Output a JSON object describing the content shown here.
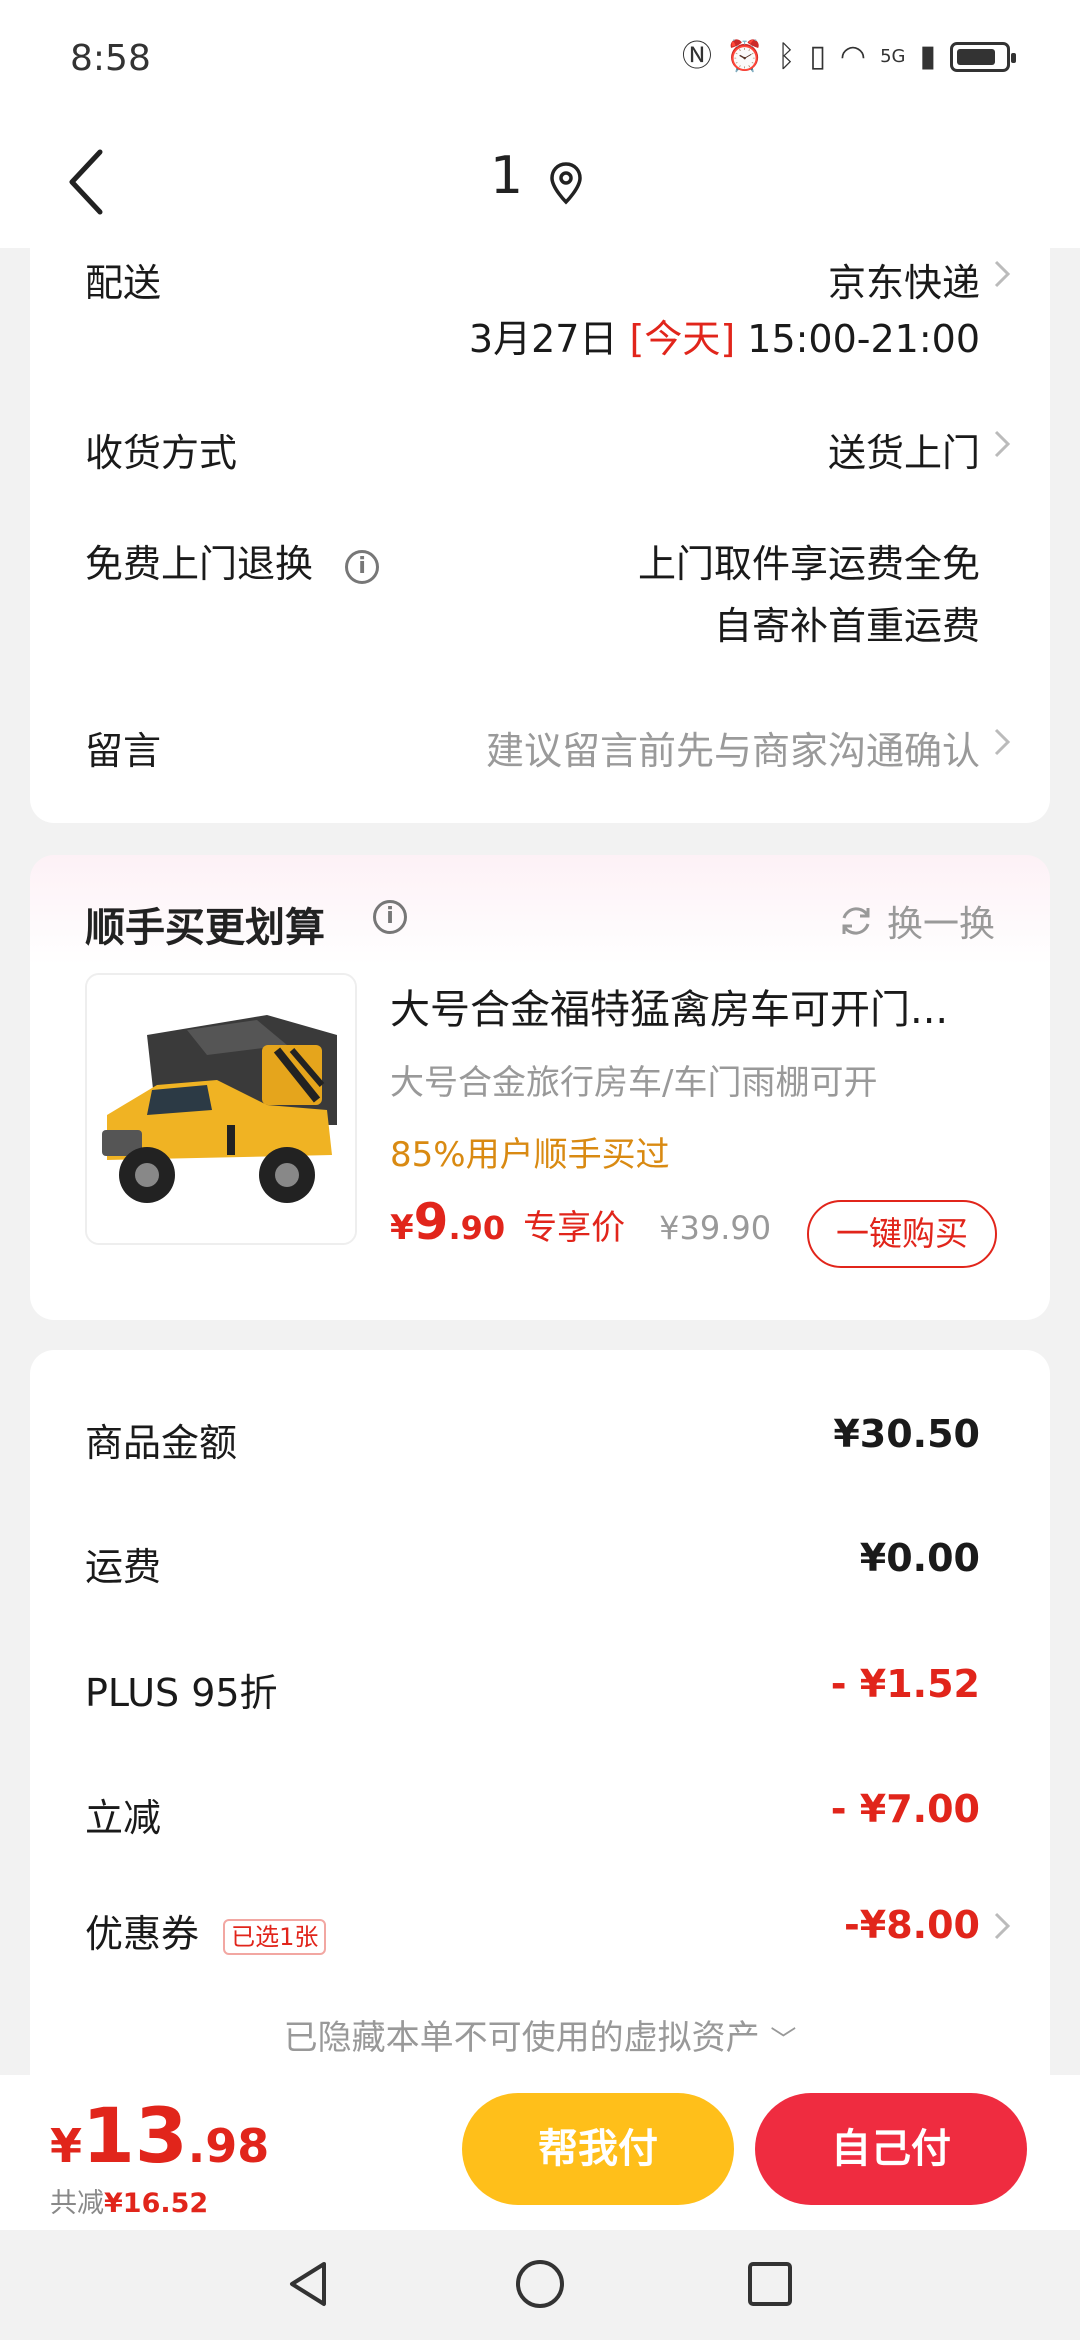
{
  "status_bar": {
    "time": "8:58",
    "network": "5G"
  },
  "header": {
    "title": "1"
  },
  "delivery": {
    "label": "配送",
    "carrier": "京东快递",
    "date": "3月27日",
    "today": "[今天]",
    "time_window": "15:00-21:00"
  },
  "receive_method": {
    "label": "收货方式",
    "value": "送货上门"
  },
  "free_return": {
    "label": "免费上门退换",
    "line1": "上门取件享运费全免",
    "line2": "自寄补首重运费"
  },
  "message": {
    "label": "留言",
    "placeholder": "建议留言前先与商家沟通确认"
  },
  "recommend": {
    "title": "顺手买更划算",
    "swap_label": "换一换",
    "product": {
      "title": "大号合金福特猛禽房车可开门...",
      "subtitle": "大号合金旅行房车/车门雨棚可开",
      "percent_text": "85%用户顺手买过",
      "price_symbol": "¥",
      "price_int": "9",
      "price_dec": ".90",
      "price_tag": "专享价",
      "original_price": "¥39.90",
      "buy_label": "一键购买"
    }
  },
  "summary": {
    "goods": {
      "label": "商品金额",
      "value": "¥30.50"
    },
    "shipping": {
      "label": "运费",
      "value": "¥0.00"
    },
    "plus": {
      "label": "PLUS 95折",
      "value": "- ¥1.52"
    },
    "instant": {
      "label": "立减",
      "value": "- ¥7.00"
    },
    "coupon": {
      "label": "优惠券",
      "tag": "已选1张",
      "value": "-¥8.00"
    },
    "hidden_note": "已隐藏本单不可使用的虚拟资产"
  },
  "bottom": {
    "total_symbol": "¥",
    "total_int": "13",
    "total_dec": ".98",
    "saved_label": "共减",
    "saved_value": "¥16.52",
    "help_pay": "帮我付",
    "self_pay": "自己付"
  },
  "colors": {
    "accent_red": "#e1251b",
    "pay_yellow": "#ffbf1a",
    "pay_red": "#ef2c40",
    "highlight_orange": "#d98a12"
  }
}
